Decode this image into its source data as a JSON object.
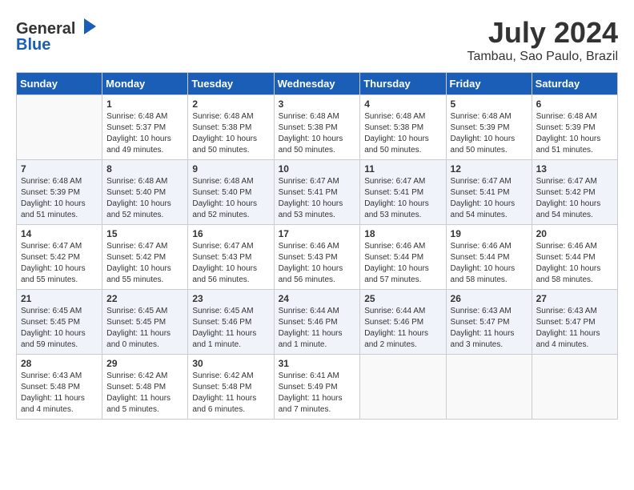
{
  "header": {
    "logo_line1": "General",
    "logo_line2": "Blue",
    "month_year": "July 2024",
    "location": "Tambau, Sao Paulo, Brazil"
  },
  "weekdays": [
    "Sunday",
    "Monday",
    "Tuesday",
    "Wednesday",
    "Thursday",
    "Friday",
    "Saturday"
  ],
  "weeks": [
    [
      {
        "day": "",
        "sunrise": "",
        "sunset": "",
        "daylight": ""
      },
      {
        "day": "1",
        "sunrise": "Sunrise: 6:48 AM",
        "sunset": "Sunset: 5:37 PM",
        "daylight": "Daylight: 10 hours and 49 minutes."
      },
      {
        "day": "2",
        "sunrise": "Sunrise: 6:48 AM",
        "sunset": "Sunset: 5:38 PM",
        "daylight": "Daylight: 10 hours and 50 minutes."
      },
      {
        "day": "3",
        "sunrise": "Sunrise: 6:48 AM",
        "sunset": "Sunset: 5:38 PM",
        "daylight": "Daylight: 10 hours and 50 minutes."
      },
      {
        "day": "4",
        "sunrise": "Sunrise: 6:48 AM",
        "sunset": "Sunset: 5:38 PM",
        "daylight": "Daylight: 10 hours and 50 minutes."
      },
      {
        "day": "5",
        "sunrise": "Sunrise: 6:48 AM",
        "sunset": "Sunset: 5:39 PM",
        "daylight": "Daylight: 10 hours and 50 minutes."
      },
      {
        "day": "6",
        "sunrise": "Sunrise: 6:48 AM",
        "sunset": "Sunset: 5:39 PM",
        "daylight": "Daylight: 10 hours and 51 minutes."
      }
    ],
    [
      {
        "day": "7",
        "sunrise": "Sunrise: 6:48 AM",
        "sunset": "Sunset: 5:39 PM",
        "daylight": "Daylight: 10 hours and 51 minutes."
      },
      {
        "day": "8",
        "sunrise": "Sunrise: 6:48 AM",
        "sunset": "Sunset: 5:40 PM",
        "daylight": "Daylight: 10 hours and 52 minutes."
      },
      {
        "day": "9",
        "sunrise": "Sunrise: 6:48 AM",
        "sunset": "Sunset: 5:40 PM",
        "daylight": "Daylight: 10 hours and 52 minutes."
      },
      {
        "day": "10",
        "sunrise": "Sunrise: 6:47 AM",
        "sunset": "Sunset: 5:41 PM",
        "daylight": "Daylight: 10 hours and 53 minutes."
      },
      {
        "day": "11",
        "sunrise": "Sunrise: 6:47 AM",
        "sunset": "Sunset: 5:41 PM",
        "daylight": "Daylight: 10 hours and 53 minutes."
      },
      {
        "day": "12",
        "sunrise": "Sunrise: 6:47 AM",
        "sunset": "Sunset: 5:41 PM",
        "daylight": "Daylight: 10 hours and 54 minutes."
      },
      {
        "day": "13",
        "sunrise": "Sunrise: 6:47 AM",
        "sunset": "Sunset: 5:42 PM",
        "daylight": "Daylight: 10 hours and 54 minutes."
      }
    ],
    [
      {
        "day": "14",
        "sunrise": "Sunrise: 6:47 AM",
        "sunset": "Sunset: 5:42 PM",
        "daylight": "Daylight: 10 hours and 55 minutes."
      },
      {
        "day": "15",
        "sunrise": "Sunrise: 6:47 AM",
        "sunset": "Sunset: 5:42 PM",
        "daylight": "Daylight: 10 hours and 55 minutes."
      },
      {
        "day": "16",
        "sunrise": "Sunrise: 6:47 AM",
        "sunset": "Sunset: 5:43 PM",
        "daylight": "Daylight: 10 hours and 56 minutes."
      },
      {
        "day": "17",
        "sunrise": "Sunrise: 6:46 AM",
        "sunset": "Sunset: 5:43 PM",
        "daylight": "Daylight: 10 hours and 56 minutes."
      },
      {
        "day": "18",
        "sunrise": "Sunrise: 6:46 AM",
        "sunset": "Sunset: 5:44 PM",
        "daylight": "Daylight: 10 hours and 57 minutes."
      },
      {
        "day": "19",
        "sunrise": "Sunrise: 6:46 AM",
        "sunset": "Sunset: 5:44 PM",
        "daylight": "Daylight: 10 hours and 58 minutes."
      },
      {
        "day": "20",
        "sunrise": "Sunrise: 6:46 AM",
        "sunset": "Sunset: 5:44 PM",
        "daylight": "Daylight: 10 hours and 58 minutes."
      }
    ],
    [
      {
        "day": "21",
        "sunrise": "Sunrise: 6:45 AM",
        "sunset": "Sunset: 5:45 PM",
        "daylight": "Daylight: 10 hours and 59 minutes."
      },
      {
        "day": "22",
        "sunrise": "Sunrise: 6:45 AM",
        "sunset": "Sunset: 5:45 PM",
        "daylight": "Daylight: 11 hours and 0 minutes."
      },
      {
        "day": "23",
        "sunrise": "Sunrise: 6:45 AM",
        "sunset": "Sunset: 5:46 PM",
        "daylight": "Daylight: 11 hours and 1 minute."
      },
      {
        "day": "24",
        "sunrise": "Sunrise: 6:44 AM",
        "sunset": "Sunset: 5:46 PM",
        "daylight": "Daylight: 11 hours and 1 minute."
      },
      {
        "day": "25",
        "sunrise": "Sunrise: 6:44 AM",
        "sunset": "Sunset: 5:46 PM",
        "daylight": "Daylight: 11 hours and 2 minutes."
      },
      {
        "day": "26",
        "sunrise": "Sunrise: 6:43 AM",
        "sunset": "Sunset: 5:47 PM",
        "daylight": "Daylight: 11 hours and 3 minutes."
      },
      {
        "day": "27",
        "sunrise": "Sunrise: 6:43 AM",
        "sunset": "Sunset: 5:47 PM",
        "daylight": "Daylight: 11 hours and 4 minutes."
      }
    ],
    [
      {
        "day": "28",
        "sunrise": "Sunrise: 6:43 AM",
        "sunset": "Sunset: 5:48 PM",
        "daylight": "Daylight: 11 hours and 4 minutes."
      },
      {
        "day": "29",
        "sunrise": "Sunrise: 6:42 AM",
        "sunset": "Sunset: 5:48 PM",
        "daylight": "Daylight: 11 hours and 5 minutes."
      },
      {
        "day": "30",
        "sunrise": "Sunrise: 6:42 AM",
        "sunset": "Sunset: 5:48 PM",
        "daylight": "Daylight: 11 hours and 6 minutes."
      },
      {
        "day": "31",
        "sunrise": "Sunrise: 6:41 AM",
        "sunset": "Sunset: 5:49 PM",
        "daylight": "Daylight: 11 hours and 7 minutes."
      },
      {
        "day": "",
        "sunrise": "",
        "sunset": "",
        "daylight": ""
      },
      {
        "day": "",
        "sunrise": "",
        "sunset": "",
        "daylight": ""
      },
      {
        "day": "",
        "sunrise": "",
        "sunset": "",
        "daylight": ""
      }
    ]
  ]
}
